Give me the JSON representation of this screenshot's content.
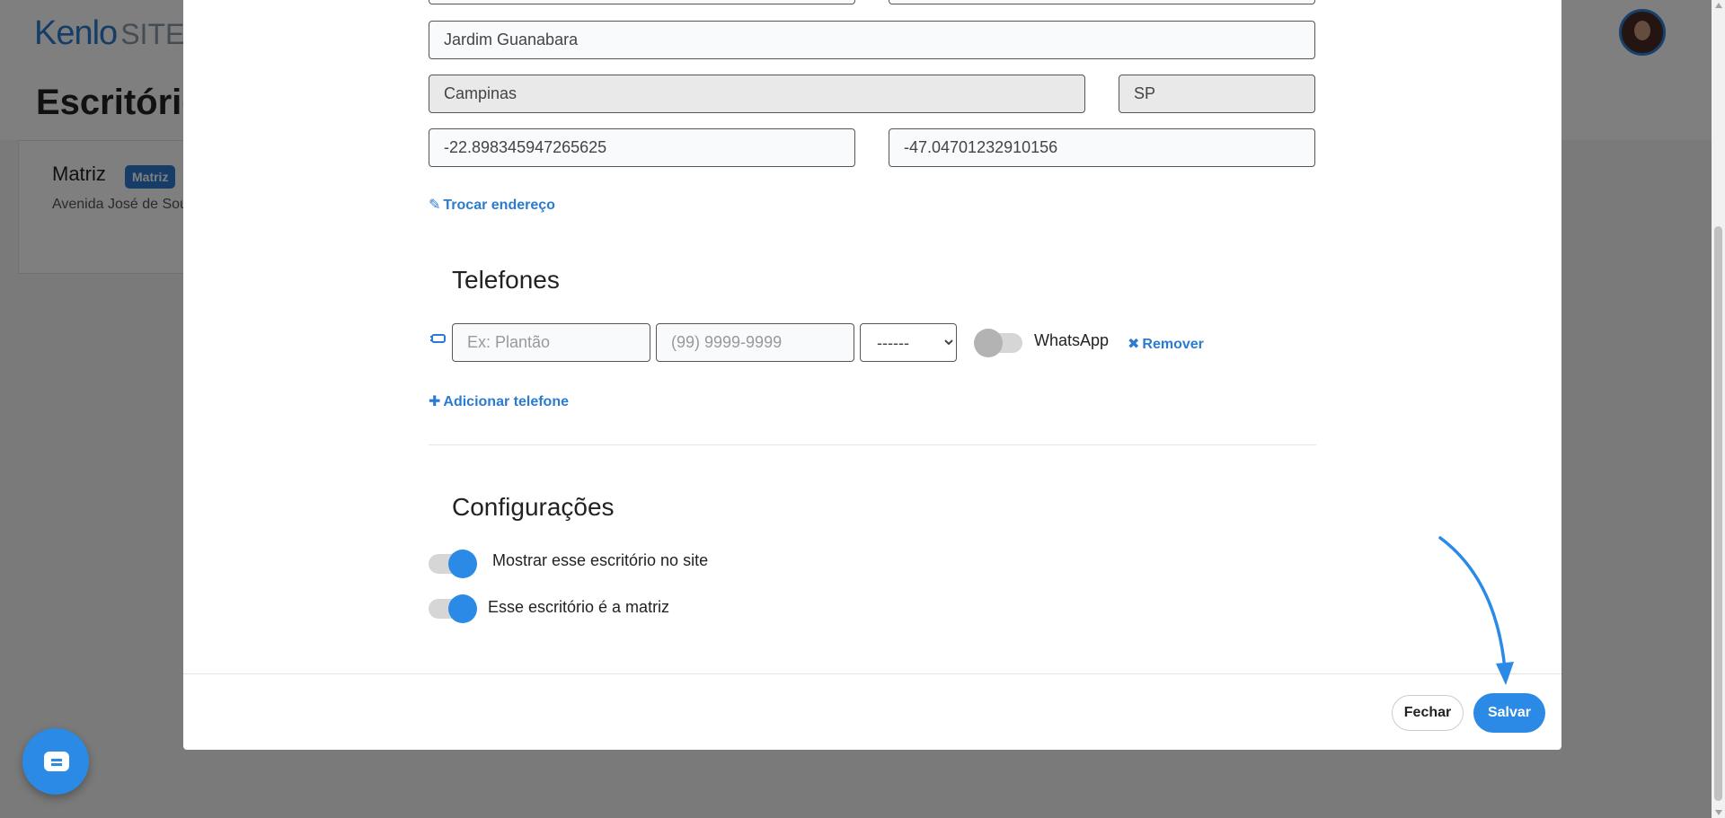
{
  "background": {
    "logo_main": "Kenlo",
    "logo_sub": "SITE",
    "page_title": "Escritório",
    "office_card": {
      "name": "Matriz",
      "badge": "Matriz",
      "address": "Avenida José de Sousa"
    }
  },
  "modal": {
    "address": {
      "neighborhood": "Jardim Guanabara",
      "city": "Campinas",
      "state": "SP",
      "latitude": "-22.898345947265625",
      "longitude": "-47.04701232910156",
      "change_address_label": "Trocar endereço"
    },
    "phones": {
      "title": "Telefones",
      "label_placeholder": "Ex: Plantão",
      "number_placeholder": "(99) 9999-9999",
      "type_selected": "------",
      "whatsapp_label": "WhatsApp",
      "remove_label": "Remover",
      "add_label": "Adicionar telefone"
    },
    "settings": {
      "title": "Configurações",
      "show_on_site_label": "Mostrar esse escritório no site",
      "is_main_label": "Esse escritório é a matriz"
    },
    "footer": {
      "close_label": "Fechar",
      "save_label": "Salvar"
    }
  },
  "colors": {
    "accent": "#2b8ae6",
    "link": "#2b7bd0"
  },
  "icons": {
    "edit": "edit-icon",
    "phone": "phone-icon",
    "remove": "close-icon",
    "add": "plus-icon",
    "chat": "chat-icon"
  }
}
